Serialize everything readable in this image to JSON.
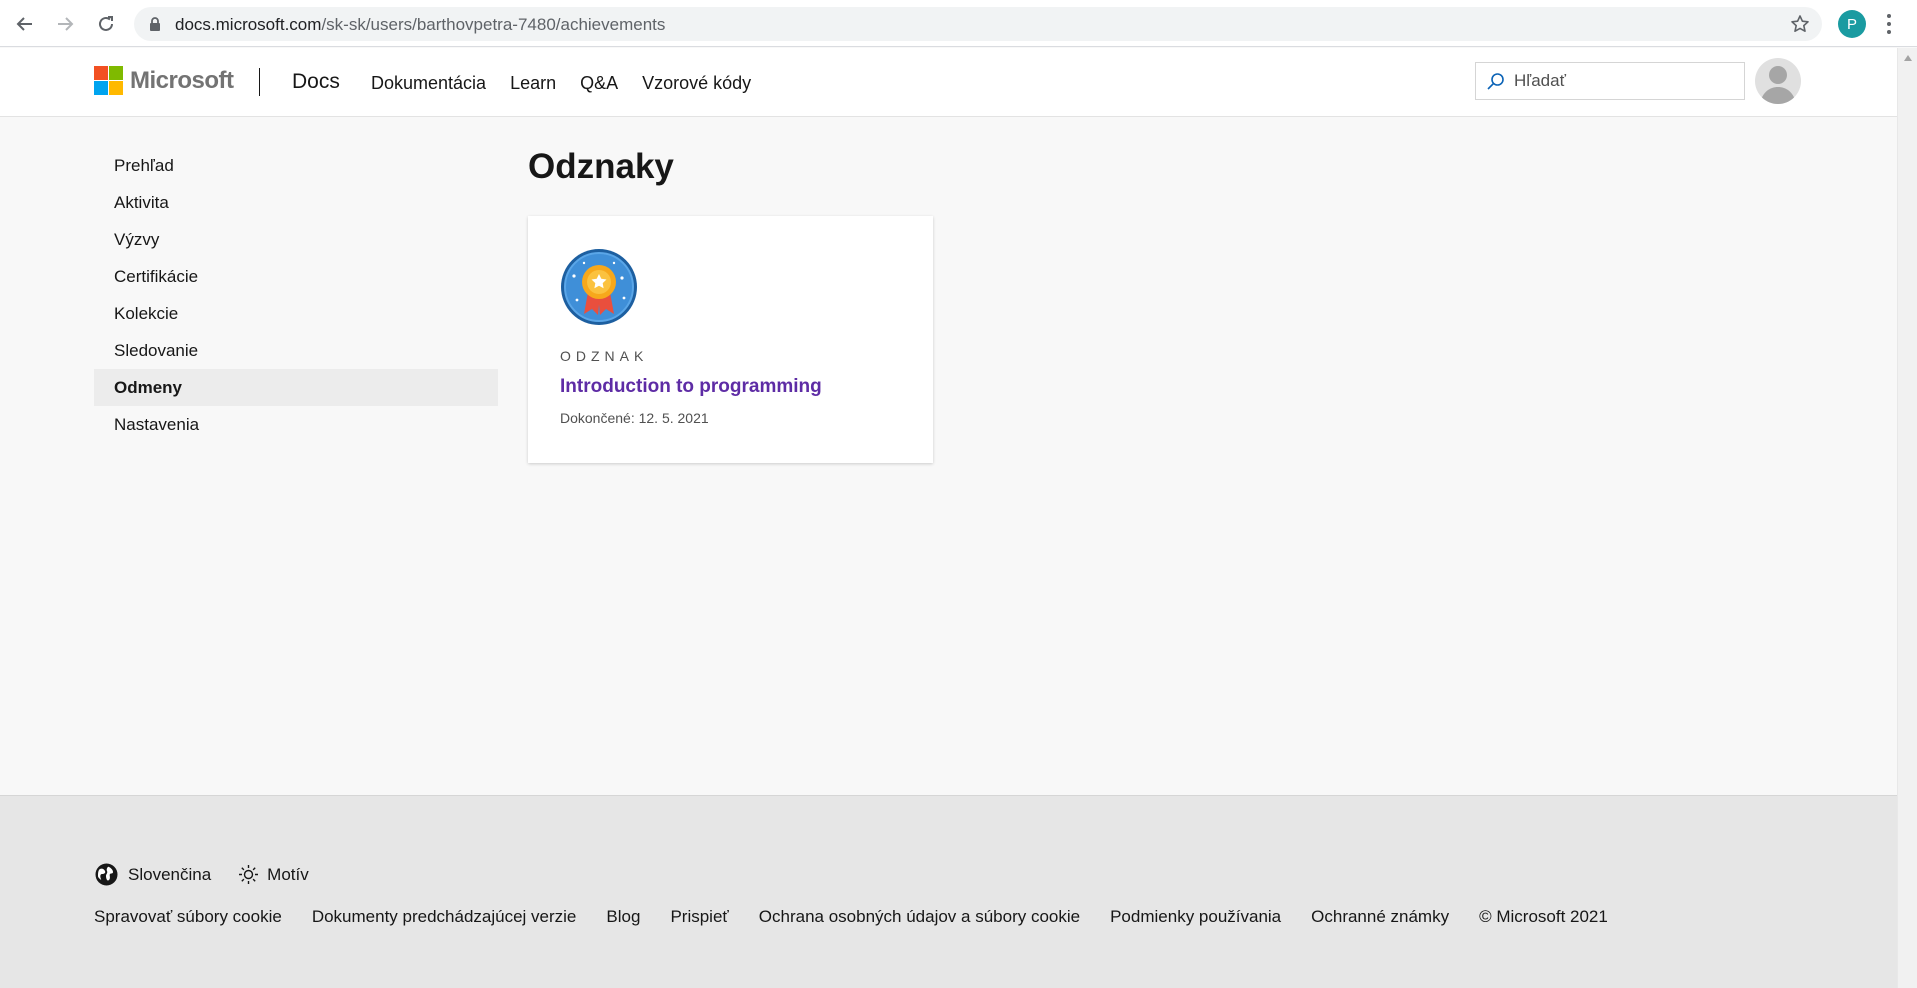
{
  "browser": {
    "url_host": "docs.microsoft.com",
    "url_path": "/sk-sk/users/barthovpetra-7480/achievements",
    "profile_initial": "P"
  },
  "header": {
    "brand": "Microsoft",
    "product": "Docs",
    "nav": [
      "Dokumentácia",
      "Learn",
      "Q&A",
      "Vzorové kódy"
    ],
    "search_placeholder": "Hľadať"
  },
  "sidebar": {
    "items": [
      "Prehľad",
      "Aktivita",
      "Výzvy",
      "Certifikácie",
      "Kolekcie",
      "Sledovanie",
      "Odmeny",
      "Nastavenia"
    ],
    "active": "Odmeny"
  },
  "main": {
    "title": "Odznaky",
    "badges": [
      {
        "type": "ODZNAK",
        "title": "Introduction to programming",
        "completed": "Dokončené: 12. 5. 2021"
      }
    ]
  },
  "footer": {
    "language": "Slovenčina",
    "theme": "Motív",
    "links": [
      "Spravovať súbory cookie",
      "Dokumenty predchádzajúcej verzie",
      "Blog",
      "Prispieť",
      "Ochrana osobných údajov a súbory cookie",
      "Podmienky používania",
      "Ochranné známky",
      "© Microsoft 2021"
    ]
  },
  "colors": {
    "link_purple": "#5e2ca5",
    "profile_teal": "#1a9ba1",
    "ms_red": "#f25022",
    "ms_green": "#7fba00",
    "ms_blue": "#00a4ef",
    "ms_yellow": "#ffb900"
  }
}
